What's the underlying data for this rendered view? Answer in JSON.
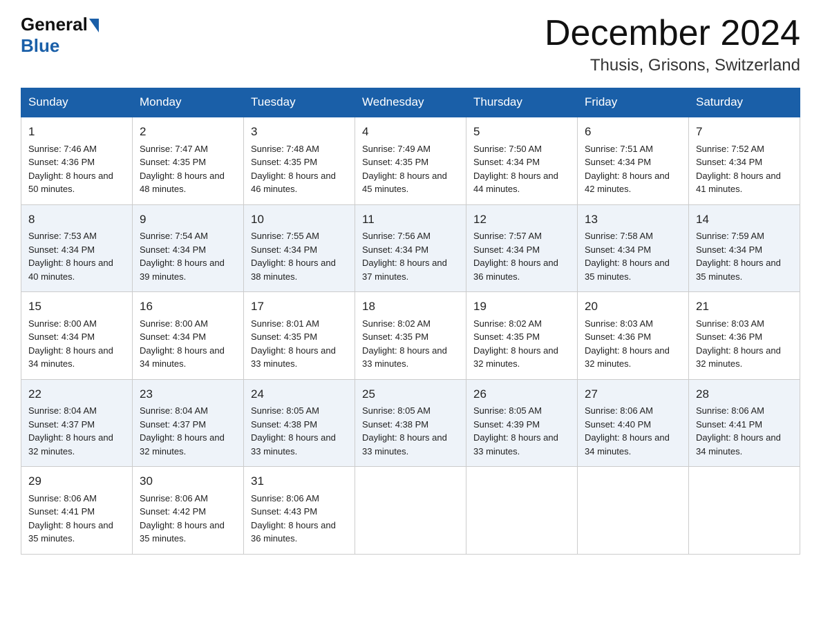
{
  "logo": {
    "general": "General",
    "blue": "Blue"
  },
  "title": "December 2024",
  "location": "Thusis, Grisons, Switzerland",
  "days_of_week": [
    "Sunday",
    "Monday",
    "Tuesday",
    "Wednesday",
    "Thursday",
    "Friday",
    "Saturday"
  ],
  "weeks": [
    [
      {
        "day": "1",
        "sunrise": "Sunrise: 7:46 AM",
        "sunset": "Sunset: 4:36 PM",
        "daylight": "Daylight: 8 hours and 50 minutes."
      },
      {
        "day": "2",
        "sunrise": "Sunrise: 7:47 AM",
        "sunset": "Sunset: 4:35 PM",
        "daylight": "Daylight: 8 hours and 48 minutes."
      },
      {
        "day": "3",
        "sunrise": "Sunrise: 7:48 AM",
        "sunset": "Sunset: 4:35 PM",
        "daylight": "Daylight: 8 hours and 46 minutes."
      },
      {
        "day": "4",
        "sunrise": "Sunrise: 7:49 AM",
        "sunset": "Sunset: 4:35 PM",
        "daylight": "Daylight: 8 hours and 45 minutes."
      },
      {
        "day": "5",
        "sunrise": "Sunrise: 7:50 AM",
        "sunset": "Sunset: 4:34 PM",
        "daylight": "Daylight: 8 hours and 44 minutes."
      },
      {
        "day": "6",
        "sunrise": "Sunrise: 7:51 AM",
        "sunset": "Sunset: 4:34 PM",
        "daylight": "Daylight: 8 hours and 42 minutes."
      },
      {
        "day": "7",
        "sunrise": "Sunrise: 7:52 AM",
        "sunset": "Sunset: 4:34 PM",
        "daylight": "Daylight: 8 hours and 41 minutes."
      }
    ],
    [
      {
        "day": "8",
        "sunrise": "Sunrise: 7:53 AM",
        "sunset": "Sunset: 4:34 PM",
        "daylight": "Daylight: 8 hours and 40 minutes."
      },
      {
        "day": "9",
        "sunrise": "Sunrise: 7:54 AM",
        "sunset": "Sunset: 4:34 PM",
        "daylight": "Daylight: 8 hours and 39 minutes."
      },
      {
        "day": "10",
        "sunrise": "Sunrise: 7:55 AM",
        "sunset": "Sunset: 4:34 PM",
        "daylight": "Daylight: 8 hours and 38 minutes."
      },
      {
        "day": "11",
        "sunrise": "Sunrise: 7:56 AM",
        "sunset": "Sunset: 4:34 PM",
        "daylight": "Daylight: 8 hours and 37 minutes."
      },
      {
        "day": "12",
        "sunrise": "Sunrise: 7:57 AM",
        "sunset": "Sunset: 4:34 PM",
        "daylight": "Daylight: 8 hours and 36 minutes."
      },
      {
        "day": "13",
        "sunrise": "Sunrise: 7:58 AM",
        "sunset": "Sunset: 4:34 PM",
        "daylight": "Daylight: 8 hours and 35 minutes."
      },
      {
        "day": "14",
        "sunrise": "Sunrise: 7:59 AM",
        "sunset": "Sunset: 4:34 PM",
        "daylight": "Daylight: 8 hours and 35 minutes."
      }
    ],
    [
      {
        "day": "15",
        "sunrise": "Sunrise: 8:00 AM",
        "sunset": "Sunset: 4:34 PM",
        "daylight": "Daylight: 8 hours and 34 minutes."
      },
      {
        "day": "16",
        "sunrise": "Sunrise: 8:00 AM",
        "sunset": "Sunset: 4:34 PM",
        "daylight": "Daylight: 8 hours and 34 minutes."
      },
      {
        "day": "17",
        "sunrise": "Sunrise: 8:01 AM",
        "sunset": "Sunset: 4:35 PM",
        "daylight": "Daylight: 8 hours and 33 minutes."
      },
      {
        "day": "18",
        "sunrise": "Sunrise: 8:02 AM",
        "sunset": "Sunset: 4:35 PM",
        "daylight": "Daylight: 8 hours and 33 minutes."
      },
      {
        "day": "19",
        "sunrise": "Sunrise: 8:02 AM",
        "sunset": "Sunset: 4:35 PM",
        "daylight": "Daylight: 8 hours and 32 minutes."
      },
      {
        "day": "20",
        "sunrise": "Sunrise: 8:03 AM",
        "sunset": "Sunset: 4:36 PM",
        "daylight": "Daylight: 8 hours and 32 minutes."
      },
      {
        "day": "21",
        "sunrise": "Sunrise: 8:03 AM",
        "sunset": "Sunset: 4:36 PM",
        "daylight": "Daylight: 8 hours and 32 minutes."
      }
    ],
    [
      {
        "day": "22",
        "sunrise": "Sunrise: 8:04 AM",
        "sunset": "Sunset: 4:37 PM",
        "daylight": "Daylight: 8 hours and 32 minutes."
      },
      {
        "day": "23",
        "sunrise": "Sunrise: 8:04 AM",
        "sunset": "Sunset: 4:37 PM",
        "daylight": "Daylight: 8 hours and 32 minutes."
      },
      {
        "day": "24",
        "sunrise": "Sunrise: 8:05 AM",
        "sunset": "Sunset: 4:38 PM",
        "daylight": "Daylight: 8 hours and 33 minutes."
      },
      {
        "day": "25",
        "sunrise": "Sunrise: 8:05 AM",
        "sunset": "Sunset: 4:38 PM",
        "daylight": "Daylight: 8 hours and 33 minutes."
      },
      {
        "day": "26",
        "sunrise": "Sunrise: 8:05 AM",
        "sunset": "Sunset: 4:39 PM",
        "daylight": "Daylight: 8 hours and 33 minutes."
      },
      {
        "day": "27",
        "sunrise": "Sunrise: 8:06 AM",
        "sunset": "Sunset: 4:40 PM",
        "daylight": "Daylight: 8 hours and 34 minutes."
      },
      {
        "day": "28",
        "sunrise": "Sunrise: 8:06 AM",
        "sunset": "Sunset: 4:41 PM",
        "daylight": "Daylight: 8 hours and 34 minutes."
      }
    ],
    [
      {
        "day": "29",
        "sunrise": "Sunrise: 8:06 AM",
        "sunset": "Sunset: 4:41 PM",
        "daylight": "Daylight: 8 hours and 35 minutes."
      },
      {
        "day": "30",
        "sunrise": "Sunrise: 8:06 AM",
        "sunset": "Sunset: 4:42 PM",
        "daylight": "Daylight: 8 hours and 35 minutes."
      },
      {
        "day": "31",
        "sunrise": "Sunrise: 8:06 AM",
        "sunset": "Sunset: 4:43 PM",
        "daylight": "Daylight: 8 hours and 36 minutes."
      },
      null,
      null,
      null,
      null
    ]
  ]
}
